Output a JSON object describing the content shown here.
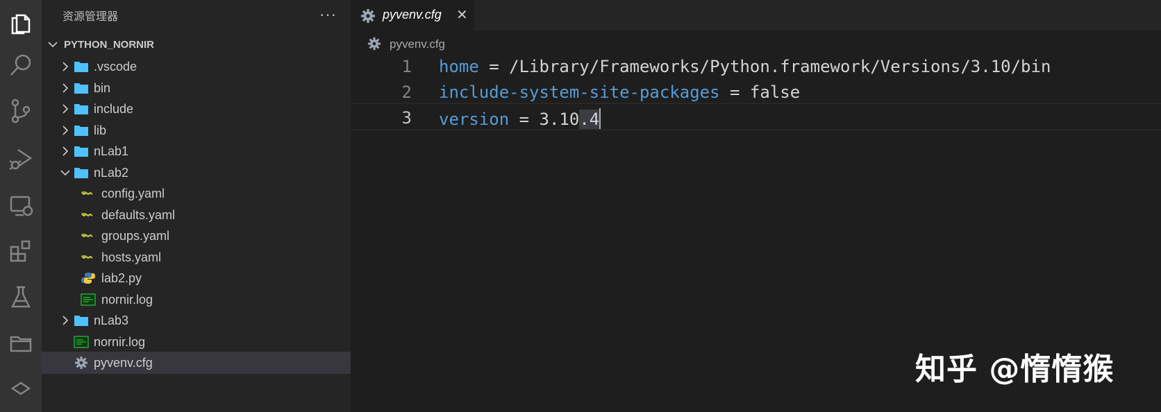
{
  "activity_bar": {
    "icons": [
      "files-icon",
      "search-icon",
      "source-control-icon",
      "run-debug-icon",
      "remote-explorer-icon",
      "extensions-icon",
      "testing-icon",
      "folder-icon",
      "docker-icon"
    ]
  },
  "sidebar": {
    "title": "资源管理器",
    "more": "···",
    "section_title": "PYTHON_NORNIR",
    "items": [
      {
        "label": ".vscode",
        "type": "folder",
        "expanded": false
      },
      {
        "label": "bin",
        "type": "folder",
        "expanded": false
      },
      {
        "label": "include",
        "type": "folder",
        "expanded": false
      },
      {
        "label": "lib",
        "type": "folder",
        "expanded": false
      },
      {
        "label": "nLab1",
        "type": "folder",
        "expanded": false
      },
      {
        "label": "nLab2",
        "type": "folder",
        "expanded": true
      },
      {
        "label": "config.yaml",
        "type": "yaml"
      },
      {
        "label": "defaults.yaml",
        "type": "yaml"
      },
      {
        "label": "groups.yaml",
        "type": "yaml"
      },
      {
        "label": "hosts.yaml",
        "type": "yaml"
      },
      {
        "label": "lab2.py",
        "type": "python"
      },
      {
        "label": "nornir.log",
        "type": "log"
      },
      {
        "label": "nLab3",
        "type": "folder",
        "expanded": false
      },
      {
        "label": "nornir.log",
        "type": "log"
      },
      {
        "label": "pyvenv.cfg",
        "type": "config",
        "selected": true
      }
    ]
  },
  "editor": {
    "tab_label": "pyvenv.cfg",
    "tab_close": "✕",
    "breadcrumb": "pyvenv.cfg",
    "lines": [
      {
        "number": "1",
        "key": "home",
        "rest": " = /Library/Frameworks/Python.framework/Versions/3.10/bin"
      },
      {
        "number": "2",
        "key": "include-system-site-packages",
        "rest": " = false"
      },
      {
        "number": "3",
        "key": "version",
        "rest_a": " = 3.10",
        "rest_hl": ".4"
      }
    ]
  },
  "watermark": "知乎 @惰惰猴",
  "colors": {
    "activity_bg": "#333333",
    "sidebar_bg": "#252526",
    "editor_bg": "#1e1e1e",
    "folder": "#4fc1ff",
    "key": "#569cd6",
    "selected_row": "#37373d"
  }
}
